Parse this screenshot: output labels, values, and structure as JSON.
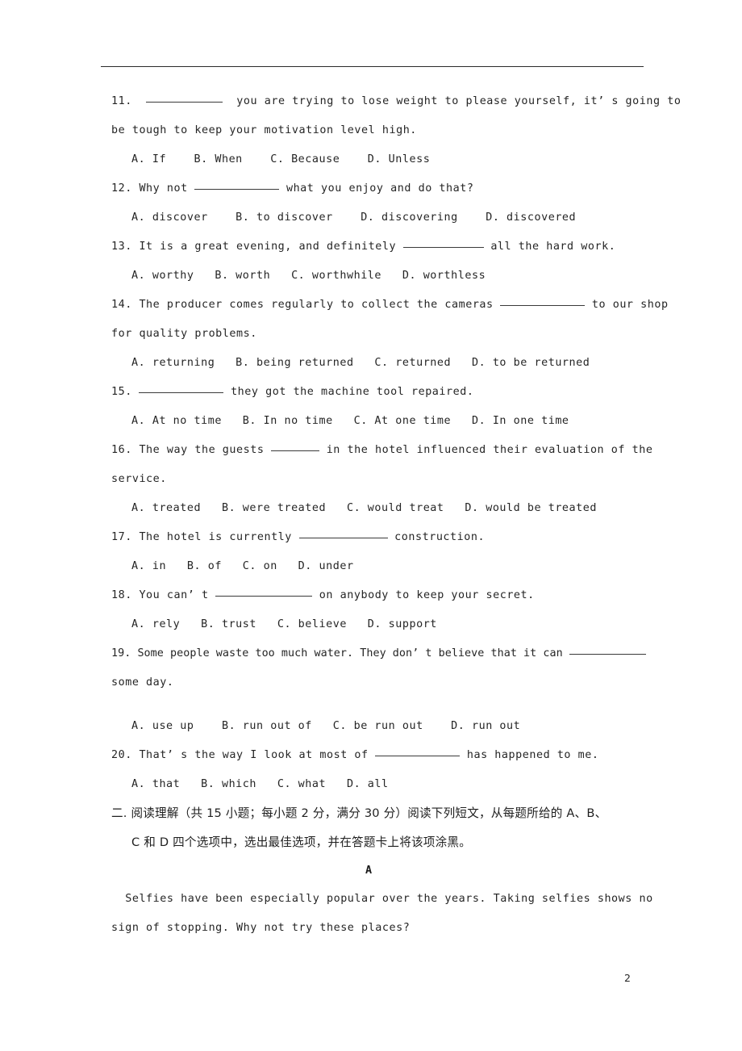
{
  "document": {
    "page_number": "2",
    "header_rule": true
  },
  "questions": [
    {
      "id": "q11",
      "lines": [
        {
          "type": "stem",
          "segments": [
            {
              "text": "11.  "
            },
            {
              "blank": "b95"
            },
            {
              "text": "  you are trying to lose weight to please yourself, it’ s going to"
            }
          ]
        },
        {
          "type": "cont",
          "segments": [
            {
              "text": "be tough to keep your motivation level high."
            }
          ]
        },
        {
          "type": "opts",
          "segments": [
            {
              "text": "A. If    B. When    C. Because    D. Unless"
            }
          ]
        }
      ]
    },
    {
      "id": "q12",
      "lines": [
        {
          "type": "stem",
          "segments": [
            {
              "text": "12. Why not "
            },
            {
              "blank": "b105"
            },
            {
              "text": " what you enjoy and do that?"
            }
          ]
        },
        {
          "type": "opts",
          "segments": [
            {
              "text": "A. discover    B. to discover    D. discovering    D. discovered"
            }
          ]
        }
      ]
    },
    {
      "id": "q13",
      "lines": [
        {
          "type": "stem",
          "segments": [
            {
              "text": "13. It is a great evening, and definitely "
            },
            {
              "blank": "b100"
            },
            {
              "text": " all the hard work."
            }
          ]
        },
        {
          "type": "opts",
          "segments": [
            {
              "text": "A. worthy   B. worth   C. worthwhile   D. worthless"
            }
          ]
        }
      ]
    },
    {
      "id": "q14",
      "lines": [
        {
          "type": "stem",
          "segments": [
            {
              "text": "14. The producer comes regularly to collect the cameras "
            },
            {
              "blank": "b105"
            },
            {
              "text": " to our shop"
            }
          ]
        },
        {
          "type": "cont",
          "segments": [
            {
              "text": "for quality problems."
            }
          ]
        },
        {
          "type": "opts",
          "segments": [
            {
              "text": "A. returning   B. being returned   C. returned   D. to be returned"
            }
          ]
        }
      ]
    },
    {
      "id": "q15",
      "lines": [
        {
          "type": "stem",
          "segments": [
            {
              "text": "15. "
            },
            {
              "blank": "b105"
            },
            {
              "text": " they got the machine tool repaired."
            }
          ]
        },
        {
          "type": "opts",
          "segments": [
            {
              "text": "A. At no time   B. In no time   C. At one time   D. In one time"
            }
          ]
        }
      ]
    },
    {
      "id": "q16",
      "lines": [
        {
          "type": "stem",
          "segments": [
            {
              "text": "16. The way the guests "
            },
            {
              "blank": "b60"
            },
            {
              "text": " in the hotel influenced their evaluation of the"
            }
          ]
        },
        {
          "type": "cont",
          "segments": [
            {
              "text": "service."
            }
          ]
        },
        {
          "type": "opts",
          "segments": [
            {
              "text": "A. treated   B. were treated   C. would treat   D. would be treated"
            }
          ]
        }
      ]
    },
    {
      "id": "q17",
      "lines": [
        {
          "type": "stem",
          "segments": [
            {
              "text": "17. The hotel is currently "
            },
            {
              "blank": "b110"
            },
            {
              "text": " construction."
            }
          ]
        },
        {
          "type": "opts",
          "segments": [
            {
              "text": "A. in   B. of   C. on   D. under"
            }
          ]
        }
      ]
    },
    {
      "id": "q18",
      "lines": [
        {
          "type": "stem",
          "segments": [
            {
              "text": "18. You can’ t "
            },
            {
              "blank": "b120"
            },
            {
              "text": " on anybody to keep your secret."
            }
          ]
        },
        {
          "type": "opts",
          "segments": [
            {
              "text": "A. rely   B. trust   C. believe   D. support"
            }
          ]
        }
      ]
    },
    {
      "id": "q19",
      "lines": [
        {
          "type": "stem-narrow",
          "segments": [
            {
              "text": "19. Some people waste too much water. They don’ t believe that it can "
            },
            {
              "blank": "b95"
            }
          ]
        },
        {
          "type": "cont",
          "segments": [
            {
              "text": "some day."
            }
          ]
        },
        {
          "type": "gap-s"
        },
        {
          "type": "opts",
          "segments": [
            {
              "text": "A. use up    B. run out of   C. be run out    D. run out"
            }
          ]
        }
      ]
    },
    {
      "id": "q20",
      "lines": [
        {
          "type": "stem",
          "segments": [
            {
              "text": "20. That’ s the way I look at most of "
            },
            {
              "blank": "b105"
            },
            {
              "text": " has happened to me."
            }
          ]
        },
        {
          "type": "opts",
          "segments": [
            {
              "text": "A. that   B. which   C. what   D. all"
            }
          ]
        }
      ]
    }
  ],
  "reading_section": {
    "instruction_line_1": "二. 阅读理解（共 15 小题；每小题 2 分，满分 30 分）阅读下列短文，从每题所给的 A、B、",
    "instruction_line_2": "C 和 D 四个选项中，选出最佳选项，并在答题卡上将该项涂黑。",
    "passage_letter": "A",
    "passage_lines": [
      "  Selfies have been especially popular over the years. Taking selfies shows no",
      "sign of stopping. Why not try these places?"
    ]
  }
}
